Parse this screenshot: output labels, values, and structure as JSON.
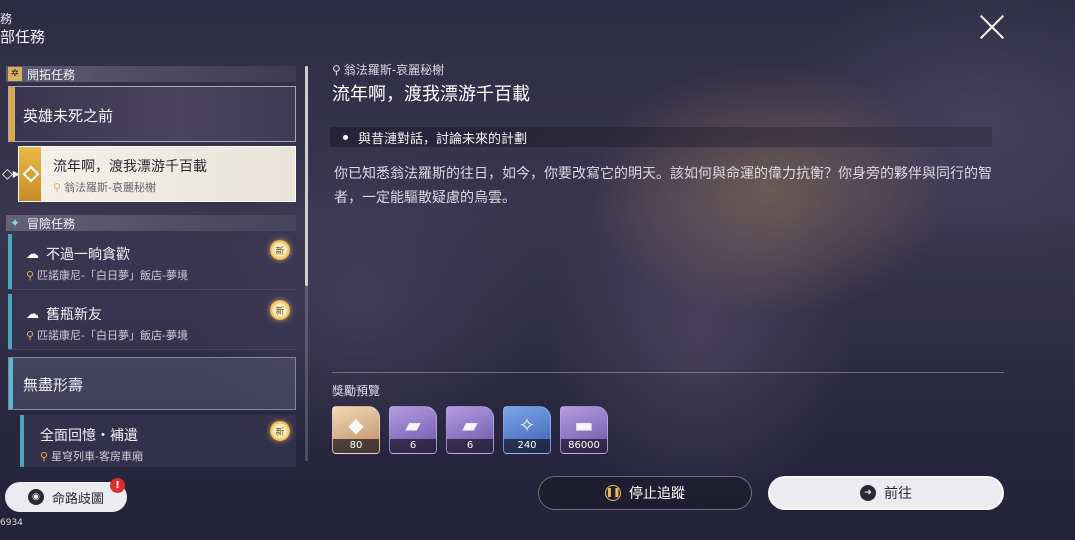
{
  "header": {
    "line1": "務",
    "line2": "部任務"
  },
  "list": {
    "trailblaze_section": "開拓任務",
    "adventure_section": "冒險任務",
    "quests": [
      {
        "title": "英雄未死之前"
      },
      {
        "title": "流年啊，渡我漂游千百載",
        "location": "翁法羅斯-哀麗秘榭"
      },
      {
        "title": "不過一晌貪歡",
        "location": "匹諾康尼-「白日夢」飯店-夢境",
        "badge": "新"
      },
      {
        "title": "舊瓶新友",
        "location": "匹諾康尼-「白日夢」飯店-夢境",
        "badge": "新"
      },
      {
        "title": "無盡形壽"
      },
      {
        "title": "全面回憶・補遺",
        "location": "星穹列車-客房車廂",
        "badge": "新"
      }
    ]
  },
  "footer": {
    "route_label": "命路歧圖",
    "alert": "!",
    "uid_fragment": "6934"
  },
  "detail": {
    "location": "翁法羅斯-哀麗秘榭",
    "title": "流年啊，渡我漂游千百載",
    "objective": "與昔漣對話，討論未來的計劃",
    "description": "你已知悉翁法羅斯的往日，如今，你要改寫它的明天。該如何與命運的偉力抗衡？你身旁的夥伴與同行的智者，一定能驅散疑慮的烏雲。"
  },
  "rewards": {
    "label": "獎勵預覽",
    "items": [
      {
        "icon": "crystal-icon",
        "count": "80"
      },
      {
        "icon": "light-cone-icon",
        "count": "6"
      },
      {
        "icon": "light-cone-icon",
        "count": "6"
      },
      {
        "icon": "exp-material-icon",
        "count": "240"
      },
      {
        "icon": "credit-icon",
        "count": "86000"
      }
    ]
  },
  "actions": {
    "stop_label": "停止追蹤",
    "go_label": "前往"
  },
  "colors": {
    "gold": "#d8a84c",
    "teal": "#4aa8b8",
    "alert": "#d9302c"
  }
}
